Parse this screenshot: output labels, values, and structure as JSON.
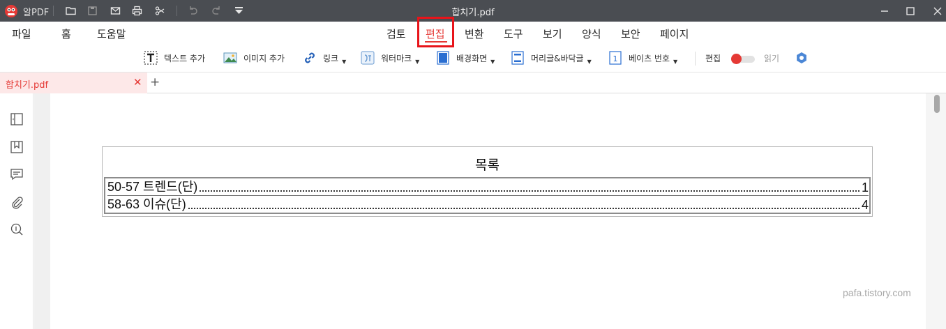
{
  "titlebar": {
    "app_name": "알PDF",
    "window_title": "합치기.pdf",
    "quick_icons": [
      "folder-icon",
      "save-icon",
      "mail-icon",
      "print-icon",
      "scissors-icon",
      "undo-icon",
      "redo-icon",
      "dropdown-icon"
    ],
    "window_controls": [
      "minimize-icon",
      "maximize-icon",
      "close-icon"
    ]
  },
  "menu": {
    "left": [
      "파일",
      "홈",
      "도움말"
    ],
    "tabs": [
      "검토",
      "편집",
      "변환",
      "도구",
      "보기",
      "양식",
      "보안",
      "페이지"
    ],
    "active_tab": "편집"
  },
  "toolbar": {
    "text_add": "텍스트 추가",
    "image_add": "이미지 추가",
    "link": "링크",
    "watermark": "워터마크",
    "background": "배경화면",
    "header_footer": "머리글&바닥글",
    "bates": "베이츠 번호",
    "mode_edit": "편집",
    "mode_read": "읽기"
  },
  "tabs": {
    "doc_tab_label": "합치기.pdf",
    "close_symbol": "✕",
    "new_tab_symbol": "+"
  },
  "sidebar": {
    "icons": [
      "panel-icon",
      "bookmark-icon",
      "comment-icon",
      "attachment-icon",
      "search-icon"
    ]
  },
  "document": {
    "toc_title": "목록",
    "rows": [
      {
        "label": "50-57 트렌드(단)",
        "page": "1"
      },
      {
        "label": "58-63 이슈(단)",
        "page": "4"
      }
    ]
  },
  "watermark": "pafa.tistory.com",
  "colors": {
    "accent": "#e53935",
    "titlebar": "#4a4d52",
    "highlight_box": "#e8141a"
  }
}
